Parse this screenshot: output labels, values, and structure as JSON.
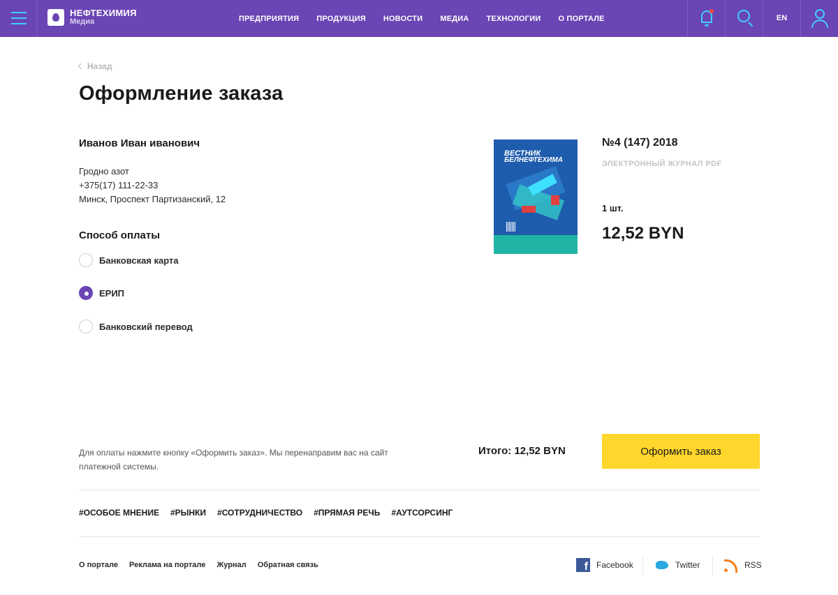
{
  "header": {
    "logo_title": "НЕФТЕХИМИЯ",
    "logo_sub": "Медиа",
    "nav": [
      "ПРЕДПРИЯТИЯ",
      "ПРОДУКЦИЯ",
      "НОВОСТИ",
      "МЕДИА",
      "ТЕХНОЛОГИИ",
      "О ПОРТАЛЕ"
    ],
    "lang": "EN"
  },
  "page": {
    "back": "Назад",
    "title": "Оформление заказа"
  },
  "customer": {
    "name": "Иванов Иван иванович",
    "company": "Гродно азот",
    "phone": "+375(17) 111-22-33",
    "address": "Минск, Проспект Партизанский, 12"
  },
  "payment": {
    "title": "Способ оплаты",
    "options": [
      {
        "label": "Банковская карта",
        "selected": false
      },
      {
        "label": "ЕРИП",
        "selected": true
      },
      {
        "label": "Банковский перевод",
        "selected": false
      }
    ]
  },
  "product": {
    "cover_title_1": "ВЕСТНИК",
    "cover_title_2": "БЕЛНЕФТЕХИМА",
    "issue": "№4 (147) 2018",
    "type": "ЭЛЕКТРОННЫЙ ЖУРНАЛ PDF",
    "qty": "1 шт.",
    "price": "12,52 BYN"
  },
  "order": {
    "note": "Для оплаты нажмите кнопку «Оформить заказ». Мы перенаправим вас на сайт платежной системы.",
    "total": "Итого: 12,52 BYN",
    "button": "Оформить заказ"
  },
  "tags": [
    "#ОСОБОЕ МНЕНИЕ",
    "#РЫНКИ",
    "#СОТРУДНИЧЕСТВО",
    "#ПРЯМАЯ РЕЧЬ",
    "#АУТСОРСИНГ"
  ],
  "footer": {
    "links": [
      "О портале",
      "Реклама на портале",
      "Журнал",
      "Обратная связь"
    ],
    "social": {
      "facebook": "Facebook",
      "twitter": "Twitter",
      "rss": "RSS"
    }
  },
  "colors": {
    "header_bg": "#6a45b4",
    "accent_icons": "#3fd0ff",
    "button_bg": "#ffd62b",
    "radio_selected": "#6a45b4"
  }
}
